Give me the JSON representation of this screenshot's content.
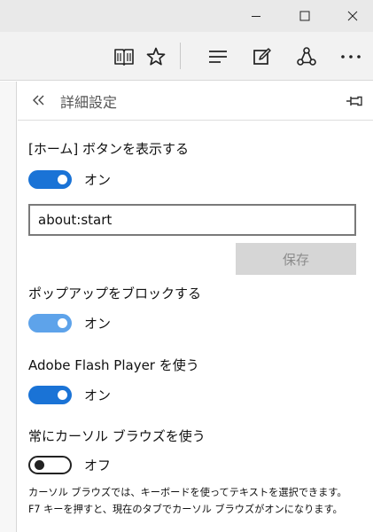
{
  "panel": {
    "title": "詳細設定"
  },
  "settings": {
    "home_button": {
      "label": "[ホーム] ボタンを表示する",
      "state": "オン",
      "url_value": "about:start",
      "save_label": "保存"
    },
    "popup_block": {
      "label": "ポップアップをブロックする",
      "state": "オン"
    },
    "flash": {
      "label": "Adobe Flash Player を使う",
      "state": "オン"
    },
    "caret_browsing": {
      "label": "常にカーソル ブラウズを使う",
      "state": "オフ",
      "description_line1": "カーソル ブラウズでは、キーボードを使ってテキストを選択できます。",
      "description_line2": "F7 キーを押すと、現在のタブでカーソル ブラウズがオンになります。"
    }
  },
  "colors": {
    "toggle_on": "#1a73d6",
    "toggle_on_light": "#5ea3ea",
    "titlebar": "#e9e9e9",
    "toolbar": "#f2f2f2"
  },
  "icons": {
    "titlebar": [
      "minimize-icon",
      "maximize-icon",
      "close-icon"
    ],
    "toolbar": [
      "reading-view-icon",
      "favorite-star-icon",
      "hub-icon",
      "web-note-icon",
      "share-icon",
      "more-icon"
    ],
    "panel": [
      "back-chevron-icon",
      "pin-icon"
    ]
  }
}
